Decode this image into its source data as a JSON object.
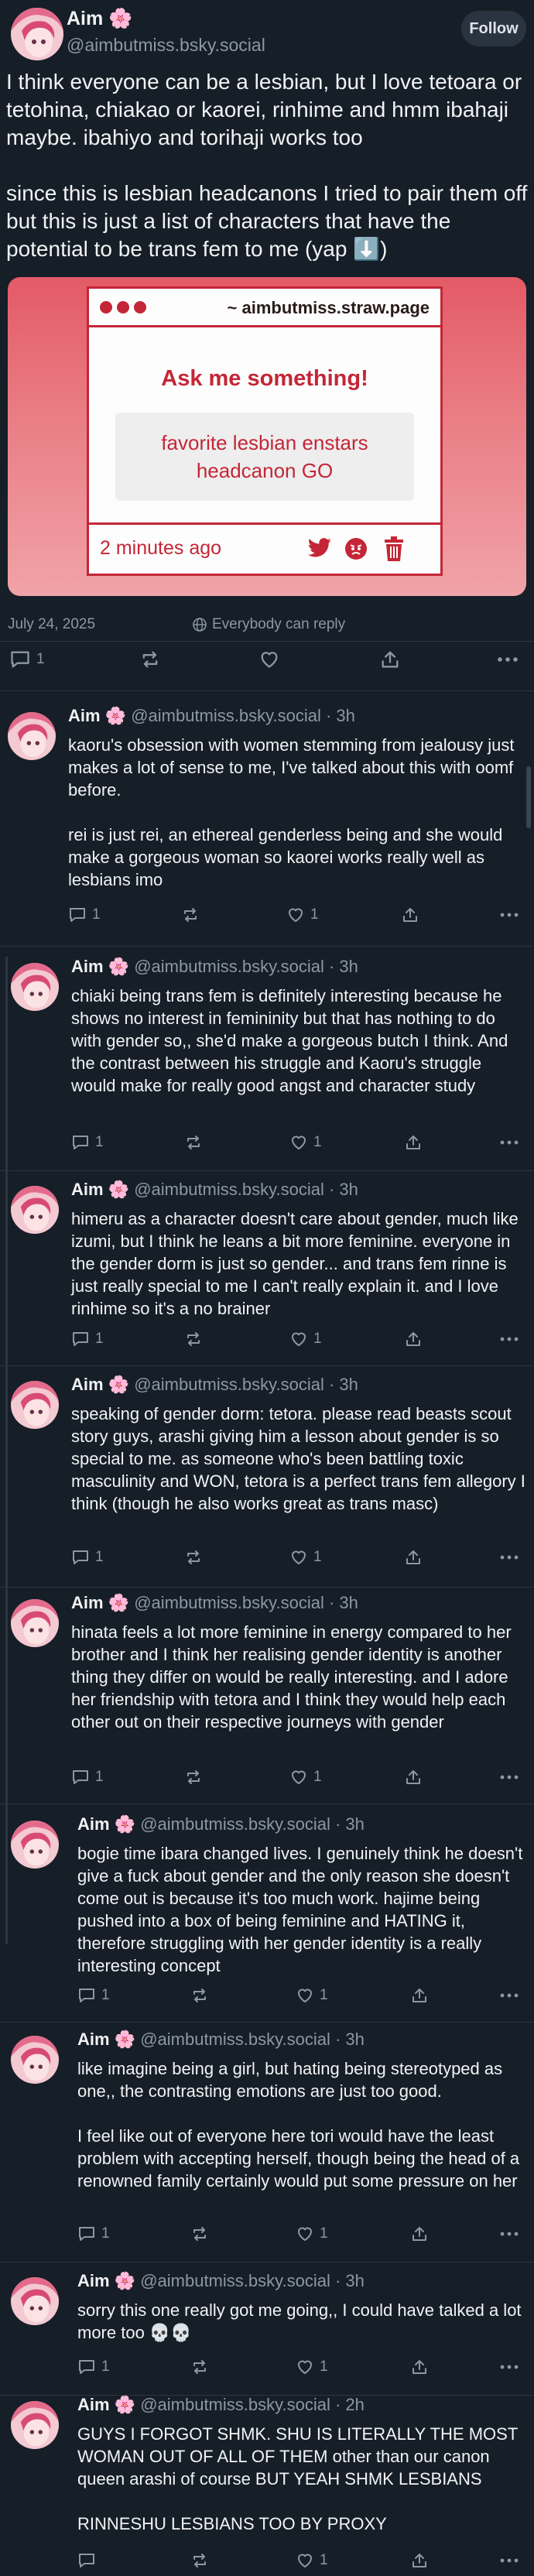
{
  "main_post": {
    "author_name": "Aim 🌸",
    "handle": "@aimbutmiss.bsky.social",
    "follow_label": "Follow",
    "paragraphs": [
      "I think everyone can be a lesbian, but I love tetoara or tetohina, chiakao or kaorei, rinhime and hmm ibahaji maybe. ibahiyo and torihaji works too",
      "since this is lesbian headcanons I tried to pair them off but this is just a list of characters that have the potential to be trans fem to me (yap ⬇️)"
    ],
    "embed": {
      "url": "~ aimbutmiss.straw.page",
      "heading": "Ask me something!",
      "box_text": "favorite lesbian enstars headcanon GO",
      "time": "2 minutes ago"
    },
    "date": "July 24, 2025",
    "reply_setting": "Everybody can reply",
    "reply_count": "1"
  },
  "replies": [
    {
      "name": "Aim 🌸",
      "handle": "@aimbutmiss.bsky.social",
      "time": "3h",
      "paragraphs": [
        "kaoru's obsession with women stemming from jealousy just makes a lot of sense to me, I've talked about this with oomf before.",
        "rei is just rei, an ethereal genderless being and she would make a gorgeous woman so kaorei works really well as lesbians imo"
      ],
      "reply_count": "1",
      "like_count": "1"
    },
    {
      "name": "Aim 🌸",
      "handle": "@aimbutmiss.bsky.social",
      "time": "3h",
      "paragraphs": [
        "chiaki being trans fem is definitely interesting because he shows no interest in femininity but that has nothing to do with gender so,, she'd make a gorgeous butch I think. And the contrast between his struggle and Kaoru's struggle would make for really good angst and character study"
      ],
      "reply_count": "1",
      "like_count": "1"
    },
    {
      "name": "Aim 🌸",
      "handle": "@aimbutmiss.bsky.social",
      "time": "3h",
      "paragraphs": [
        "himeru as a character doesn't care about gender, much like izumi, but I think he leans a bit more feminine. everyone in the gender dorm is just so gender... and trans fem rinne is just really special to me I can't really explain it. and I love rinhime so it's a no brainer"
      ],
      "reply_count": "1",
      "like_count": "1"
    },
    {
      "name": "Aim 🌸",
      "handle": "@aimbutmiss.bsky.social",
      "time": "3h",
      "paragraphs": [
        "speaking of gender dorm: tetora. please read beasts scout story guys, arashi giving him a lesson about gender is so special to me. as someone who's been battling toxic masculinity and WON, tetora is a perfect trans fem allegory I think (though he also works great as trans masc)"
      ],
      "reply_count": "1",
      "like_count": "1"
    },
    {
      "name": "Aim 🌸",
      "handle": "@aimbutmiss.bsky.social",
      "time": "3h",
      "paragraphs": [
        "hinata feels a lot more feminine in energy compared to her brother and I think her realising gender identity is another thing they differ on would be really interesting. and I adore her friendship with tetora and I think they would help each other out on their respective journeys with gender"
      ],
      "reply_count": "1",
      "like_count": "1"
    },
    {
      "name": "Aim 🌸",
      "handle": "@aimbutmiss.bsky.social",
      "time": "3h",
      "paragraphs": [
        "bogie time ibara changed lives. I genuinely think he doesn't give a fuck about gender and the only reason she doesn't come out is because it's too much work. hajime being pushed into a box of being feminine and HATING it, therefore struggling with her gender identity is a really interesting concept"
      ],
      "reply_count": "1",
      "like_count": "1"
    },
    {
      "name": "Aim 🌸",
      "handle": "@aimbutmiss.bsky.social",
      "time": "3h",
      "paragraphs": [
        "like imagine being a girl, but hating being stereotyped as one,, the contrasting emotions are just too good.",
        "I feel like out of everyone here tori would have the least problem with accepting herself, though being the head of a renowned family certainly would put some pressure on her"
      ],
      "reply_count": "1",
      "like_count": "1"
    },
    {
      "name": "Aim 🌸",
      "handle": "@aimbutmiss.bsky.social",
      "time": "3h",
      "paragraphs": [
        "sorry this one really got me going,, I could have talked a lot more too 💀💀"
      ],
      "reply_count": "1",
      "like_count": "1"
    },
    {
      "name": "Aim 🌸",
      "handle": "@aimbutmiss.bsky.social",
      "time": "2h",
      "paragraphs": [
        "GUYS I FORGOT SHMK. SHU IS LITERALLY THE MOST WOMAN OUT OF ALL OF THEM other than our canon queen arashi of course BUT YEAH SHMK LESBIANS",
        "RINNESHU LESBIANS TOO BY PROXY"
      ],
      "reply_count": "",
      "like_count": "1"
    }
  ]
}
